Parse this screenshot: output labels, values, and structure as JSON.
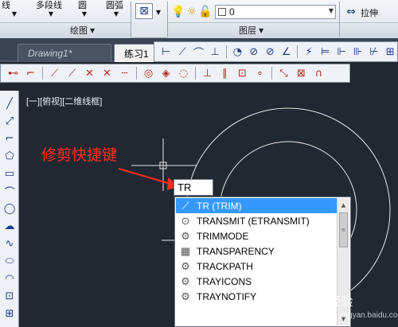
{
  "ribbon": {
    "row_labels": [
      "线",
      "多段线",
      "圆",
      "圆弧"
    ],
    "panels": {
      "draw_title": "绘图",
      "layers_title": "图层"
    },
    "layer_value": "0",
    "stretch_label": "拉伸"
  },
  "file_tabs": [
    {
      "label": "Drawing1*",
      "active": false
    },
    {
      "label": "练习1",
      "active": true
    }
  ],
  "canvas": {
    "viewport_label": "[一][俯视][二维线框]",
    "annotation": "修剪快捷键",
    "command_input": "TR"
  },
  "autocomplete": {
    "items": [
      {
        "label": "TR (TRIM)",
        "icon": "trim-icon",
        "selected": true
      },
      {
        "label": "TRANSMIT (ETRANSMIT)",
        "icon": "etransmit-icon",
        "selected": false
      },
      {
        "label": "TRIMMODE",
        "icon": "gear-icon",
        "selected": false
      },
      {
        "label": "TRANSPARENCY",
        "icon": "transparency-icon",
        "selected": false
      },
      {
        "label": "TRACKPATH",
        "icon": "gear-icon",
        "selected": false
      },
      {
        "label": "TRAYICONS",
        "icon": "gear-icon",
        "selected": false
      },
      {
        "label": "TRAYNOTIFY",
        "icon": "gear-icon",
        "selected": false
      }
    ]
  },
  "watermark": {
    "brand": "Bai 经验",
    "sub": "jingyan.baidu.com"
  },
  "colors": {
    "canvas_bg": "#222831",
    "annotation_red": "#ff2b1f",
    "selection_blue": "#3399ff"
  }
}
